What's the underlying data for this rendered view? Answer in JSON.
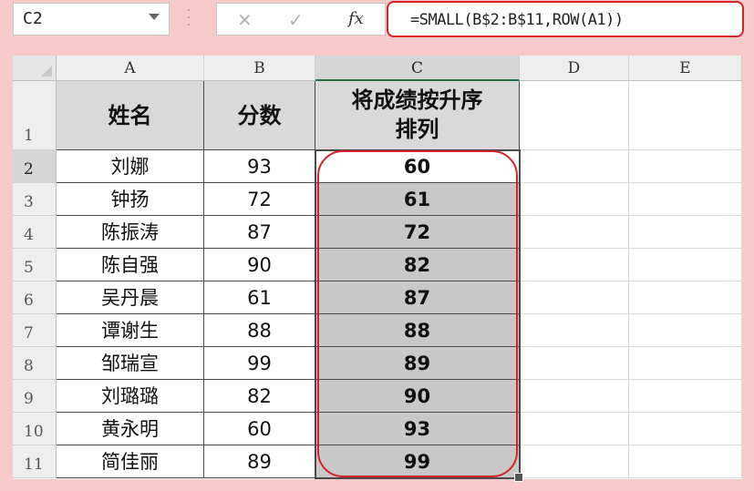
{
  "formula_bar": {
    "name_box": "C2",
    "cancel_icon": "✕",
    "confirm_icon": "✓",
    "fx_label": "fx",
    "formula": "=SMALL(B$2:B$11,ROW(A1))"
  },
  "columns": [
    "A",
    "B",
    "C",
    "D",
    "E"
  ],
  "rows": [
    "1",
    "2",
    "3",
    "4",
    "5",
    "6",
    "7",
    "8",
    "9",
    "10",
    "11"
  ],
  "headers": {
    "a": "姓名",
    "b": "分数",
    "c_line1": "将成绩按升序",
    "c_line2": "排列"
  },
  "data_rows": [
    {
      "name": "刘娜",
      "score": "93",
      "sorted": "60"
    },
    {
      "name": "钟扬",
      "score": "72",
      "sorted": "61"
    },
    {
      "name": "陈振涛",
      "score": "87",
      "sorted": "72"
    },
    {
      "name": "陈自强",
      "score": "90",
      "sorted": "82"
    },
    {
      "name": "吴丹晨",
      "score": "61",
      "sorted": "87"
    },
    {
      "name": "谭谢生",
      "score": "88",
      "sorted": "88"
    },
    {
      "name": "邹瑞宣",
      "score": "99",
      "sorted": "89"
    },
    {
      "name": "刘璐璐",
      "score": "82",
      "sorted": "90"
    },
    {
      "name": "黄永明",
      "score": "60",
      "sorted": "93"
    },
    {
      "name": "简佳丽",
      "score": "89",
      "sorted": "99"
    }
  ],
  "colors": {
    "highlight_outline": "#d6222a",
    "selected_fill": "#c8c8c8",
    "background": "#f7caca"
  }
}
